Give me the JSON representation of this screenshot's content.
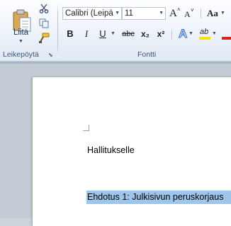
{
  "ribbon": {
    "clipboard": {
      "paste_label": "Liitä",
      "group_label": "Leikepöytä"
    },
    "font": {
      "font_name": "Calibri (Leipä",
      "font_size": "11",
      "group_label": "Fontti",
      "change_case_label": "Aa",
      "bold": "B",
      "italic": "I",
      "underline": "U",
      "strikethrough": "abc",
      "subscript": "x₂",
      "superscript": "x²",
      "grow_font": "A",
      "shrink_font": "A",
      "text_effects": "A",
      "highlight": "ab"
    }
  },
  "document": {
    "line1": "Hallitukselle",
    "line2": "Ehdotus 1: Julkisivun peruskorjaus"
  },
  "colors": {
    "highlight_selection": "#9ec6ea",
    "text_highlight_yellow": "#f5e400",
    "font_color_red": "#e02020"
  }
}
